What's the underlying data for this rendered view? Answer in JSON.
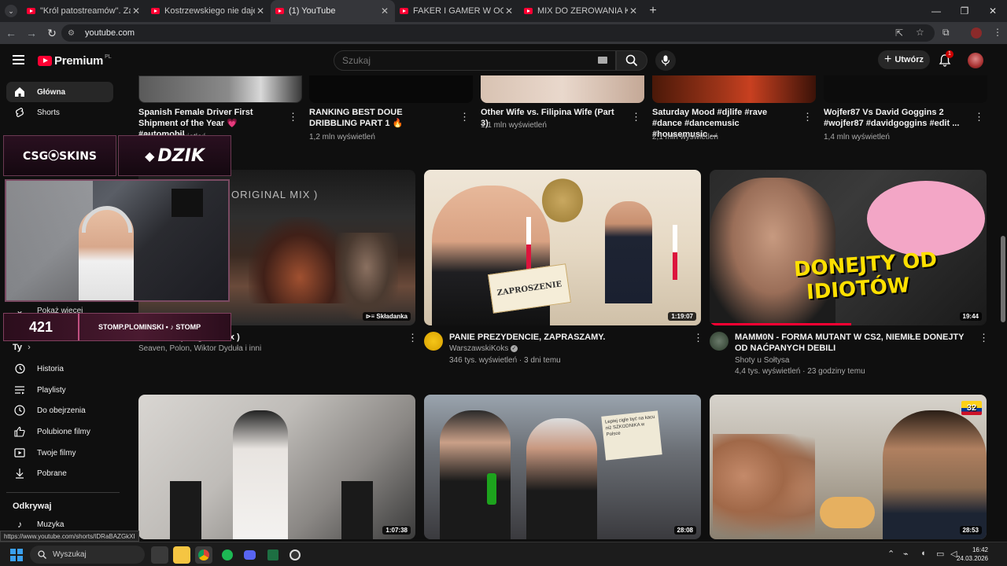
{
  "browser": {
    "tabs": [
      {
        "title": "\"Król patostreamów\". Zarabia s",
        "active": false
      },
      {
        "title": "Kostrzewskiego nie daje za wyg",
        "active": false
      },
      {
        "title": "(1) YouTube",
        "active": true
      },
      {
        "title": "FAKER I GAMER W OGNIU | UFC",
        "active": false
      },
      {
        "title": "MIX DO ZEROWANIA KAKTUSÓ",
        "active": false
      }
    ],
    "url": "youtube.com"
  },
  "header": {
    "logo_text": "Premium",
    "logo_country": "PL",
    "search_placeholder": "Szukaj",
    "create_label": "Utwórz",
    "notif_count": "1"
  },
  "sidebar": {
    "top": [
      {
        "label": "Główna",
        "icon": "home-icon"
      },
      {
        "label": "Shorts",
        "icon": "shorts-icon"
      }
    ],
    "show_more": "Pokaż więcej",
    "you_heading": "Ty",
    "you_items": [
      {
        "label": "Historia",
        "icon": "history-icon"
      },
      {
        "label": "Playlisty",
        "icon": "playlist-icon"
      },
      {
        "label": "Do obejrzenia",
        "icon": "watch-later-icon"
      },
      {
        "label": "Polubione filmy",
        "icon": "like-icon"
      },
      {
        "label": "Twoje filmy",
        "icon": "your-videos-icon"
      },
      {
        "label": "Pobrane",
        "icon": "download-icon"
      }
    ],
    "explore_heading": "Odkrywaj",
    "explore_items": [
      {
        "label": "Muzyka",
        "icon": "music-icon"
      }
    ]
  },
  "shorts": [
    {
      "title": "Spanish Female Driver First Shipment of the Year 💗 #automobil...",
      "views": "226 tys. wyświetleń"
    },
    {
      "title": "RANKING BEST DOUE DRIBBLING PART 1 🔥",
      "views": "1,2 mln wyświetleń"
    },
    {
      "title": "Other Wife vs. Filipina Wife (Part 3)",
      "views": "1,1 mln wyświetleń"
    },
    {
      "title": "Saturday Mood #djlife #rave #dance #dancemusic #housemusic ...",
      "views": "2,1 mln wyświetleń"
    },
    {
      "title": "Wojfer87 Vs David Goggins 2 #wojfer87 #davidgoggins #edit ...",
      "views": "1,4 mln wyświetleń"
    }
  ],
  "videos_row1": [
    {
      "title": "Want You ( Original Mix )",
      "channel": "Seaven, Polon, Wiktor Dyduła i inni",
      "meta": "",
      "badge": "Składanka",
      "thumb_text": "ORIGINAL MIX )"
    },
    {
      "title": "PANIE PREZYDENCIE, ZAPRASZAMY.",
      "channel": "WarszawskiKoks",
      "meta": "346 tys. wyświetleń · 3 dni temu",
      "duration": "1:19:07",
      "thumb_text": "ZAPROSZENIE"
    },
    {
      "title": "MAMM0N - FORMA MUTANT W CS2, NIEMIŁE DONEJTY OD NAĆPANYCH DEBILI",
      "channel": "Shoty u Sołtysa",
      "meta": "4,4 tys. wyświetleń · 23 godziny temu",
      "duration": "19:44",
      "thumb_text_1": "DONEJTY OD",
      "thumb_text_2": "IDIOTÓW"
    }
  ],
  "videos_row2": [
    {
      "duration": "1:07:38"
    },
    {
      "duration": "28:08",
      "sign_text": "Lepiej cigle być na kacu niż SZKODNIKA w Polsce"
    },
    {
      "duration": "28:53",
      "badge": "32"
    }
  ],
  "overlay": {
    "logo1": "CSG⦿SKINS",
    "logo2": "DZIK",
    "count": "421",
    "socials": "STOMP.PLOMINSKI • ♪ STOMP"
  },
  "status_url": "https://www.youtube.com/shorts/IDRaBAZGkXI",
  "taskbar": {
    "search_label": "Wyszukaj",
    "time": "16:42",
    "date": "24.03.2026"
  },
  "colors": {
    "bg": "#0f0f0f",
    "brand_red": "#ff0033",
    "text_secondary": "#aaaaaa"
  }
}
